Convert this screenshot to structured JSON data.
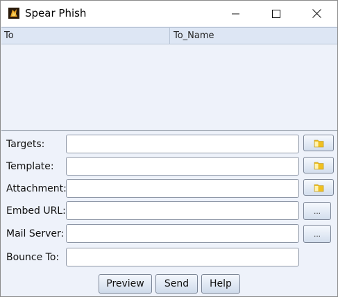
{
  "window": {
    "title": "Spear Phish",
    "icon": "app-icon",
    "controls": [
      "minimize-icon",
      "maximize-icon",
      "close-icon"
    ]
  },
  "table": {
    "columns": [
      "To",
      "To_Name"
    ],
    "rows": []
  },
  "form": {
    "targets_label": "Targets:",
    "targets_value": "",
    "template_label": "Template:",
    "template_value": "",
    "attachment_label": "Attachment:",
    "attachment_value": "",
    "embed_url_label": "Embed URL:",
    "embed_url_value": "",
    "mail_server_label": "Mail Server:",
    "mail_server_value": "",
    "bounce_to_label": "Bounce To:",
    "bounce_to_value": "",
    "ellipsis_label": "..."
  },
  "buttons": {
    "preview": "Preview",
    "send": "Send",
    "help": "Help"
  },
  "colors": {
    "panel": "#eef2fa",
    "header": "#dde6f4",
    "folder": "#f0c020"
  }
}
